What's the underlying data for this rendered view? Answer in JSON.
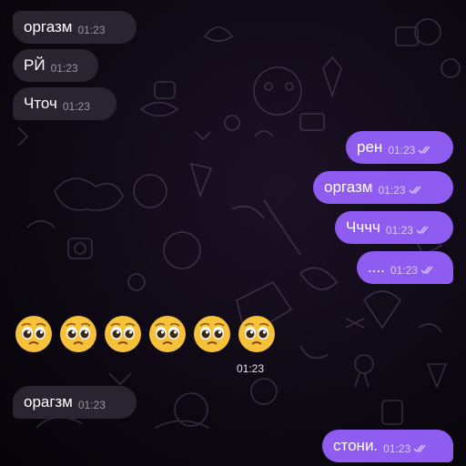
{
  "messages": {
    "m1": {
      "text": "оргазм",
      "time": "01:23"
    },
    "m2": {
      "text": "РЙ",
      "time": "01:23"
    },
    "m3": {
      "text": "Чточ",
      "time": "01:23"
    },
    "m4": {
      "text": "рен",
      "time": "01:23"
    },
    "m5": {
      "text": "оргазм",
      "time": "01:23"
    },
    "m6": {
      "text": "Чччч",
      "time": "01:23"
    },
    "m7": {
      "text": "....",
      "time": "01:23"
    },
    "m8": {
      "emoji": "🥺🥺🥺🥺🥺🥺",
      "time": "01:23"
    },
    "m9": {
      "text": "орагзм",
      "time": "01:23"
    },
    "m10": {
      "text": "стони.",
      "time": "01:23"
    }
  },
  "colors": {
    "incoming_bubble": "#2a2431",
    "outgoing_bubble": "#8f5cf2",
    "background": "#0b0610"
  },
  "icons": {
    "read_receipt": "double-check-icon",
    "emoji": "pleading-face-icon"
  }
}
